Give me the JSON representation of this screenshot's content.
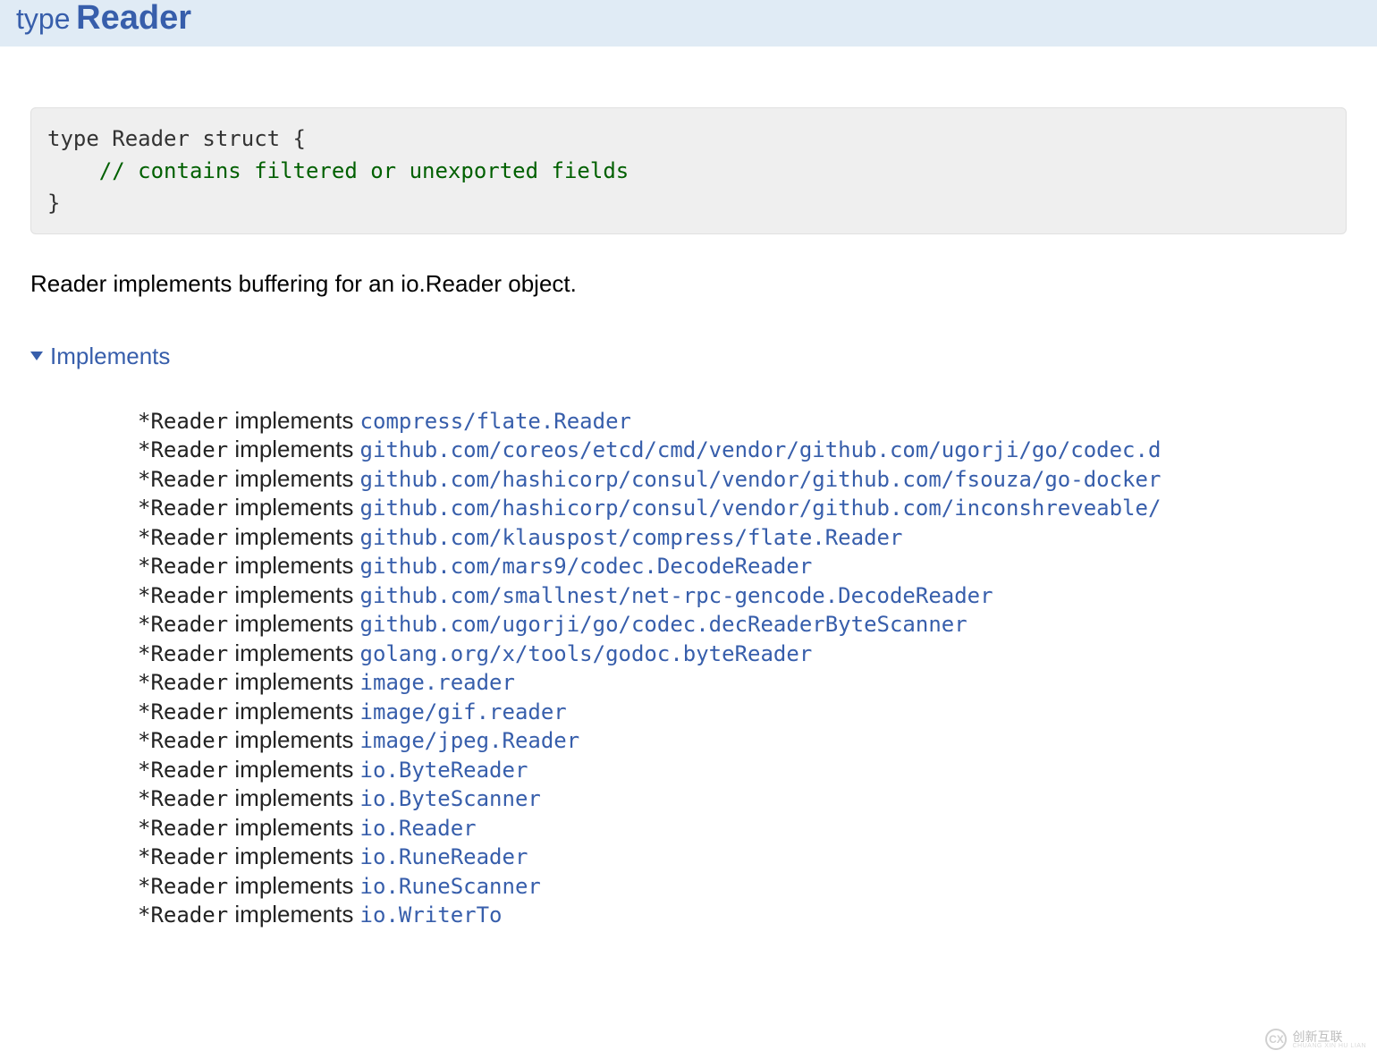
{
  "header": {
    "keyword": "type",
    "name": "Reader"
  },
  "code": {
    "line1": "type Reader struct {",
    "comment": "// contains filtered or unexported fields",
    "line3": "}"
  },
  "description": "Reader implements buffering for an io.Reader object.",
  "implements_label": "Implements",
  "impl_prefix": "*Reader",
  "impl_verb": " implements ",
  "implements": [
    "compress/flate.Reader",
    "github.com/coreos/etcd/cmd/vendor/github.com/ugorji/go/codec.d",
    "github.com/hashicorp/consul/vendor/github.com/fsouza/go-docker",
    "github.com/hashicorp/consul/vendor/github.com/inconshreveable/",
    "github.com/klauspost/compress/flate.Reader",
    "github.com/mars9/codec.DecodeReader",
    "github.com/smallnest/net-rpc-gencode.DecodeReader",
    "github.com/ugorji/go/codec.decReaderByteScanner",
    "golang.org/x/tools/godoc.byteReader",
    "image.reader",
    "image/gif.reader",
    "image/jpeg.Reader",
    "io.ByteReader",
    "io.ByteScanner",
    "io.Reader",
    "io.RuneReader",
    "io.RuneScanner",
    "io.WriterTo"
  ],
  "watermark": {
    "logo_text": "CX",
    "zh": "创新互联",
    "en": "CHUANG XIN HU LIAN"
  }
}
